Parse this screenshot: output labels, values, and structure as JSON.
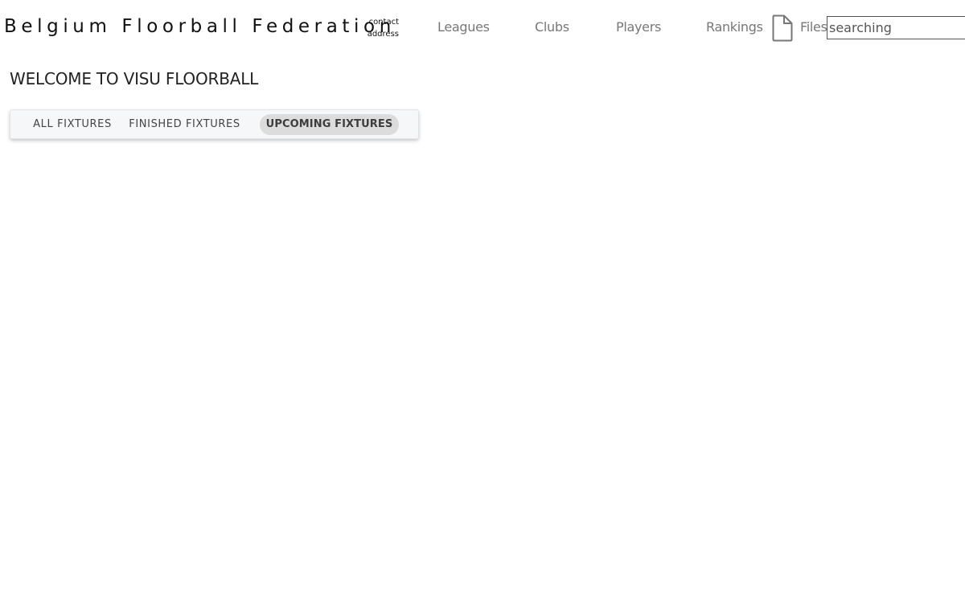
{
  "header": {
    "brand": "Belgium Floorball Federation",
    "contact": {
      "line1": "contact",
      "line2": "address"
    },
    "nav": [
      {
        "label": "Leagues"
      },
      {
        "label": "Clubs"
      },
      {
        "label": "Players"
      },
      {
        "label": "Rankings"
      },
      {
        "label": "Files",
        "icon": "file-icon"
      }
    ],
    "search": {
      "value": "",
      "placeholder": "searching"
    }
  },
  "main": {
    "title": "WELCOME TO VISU FLOORBALL",
    "tabs": [
      {
        "label": "ALL FIXTURES",
        "active": false
      },
      {
        "label": "FINISHED FIXTURES",
        "active": false
      },
      {
        "label": "UPCOMING FIXTURES",
        "active": true
      }
    ]
  },
  "colors": {
    "nav_text": "#777777",
    "tab_active_bg": "#dcdcdc",
    "tabbar_bg": "#f6f7f9"
  }
}
